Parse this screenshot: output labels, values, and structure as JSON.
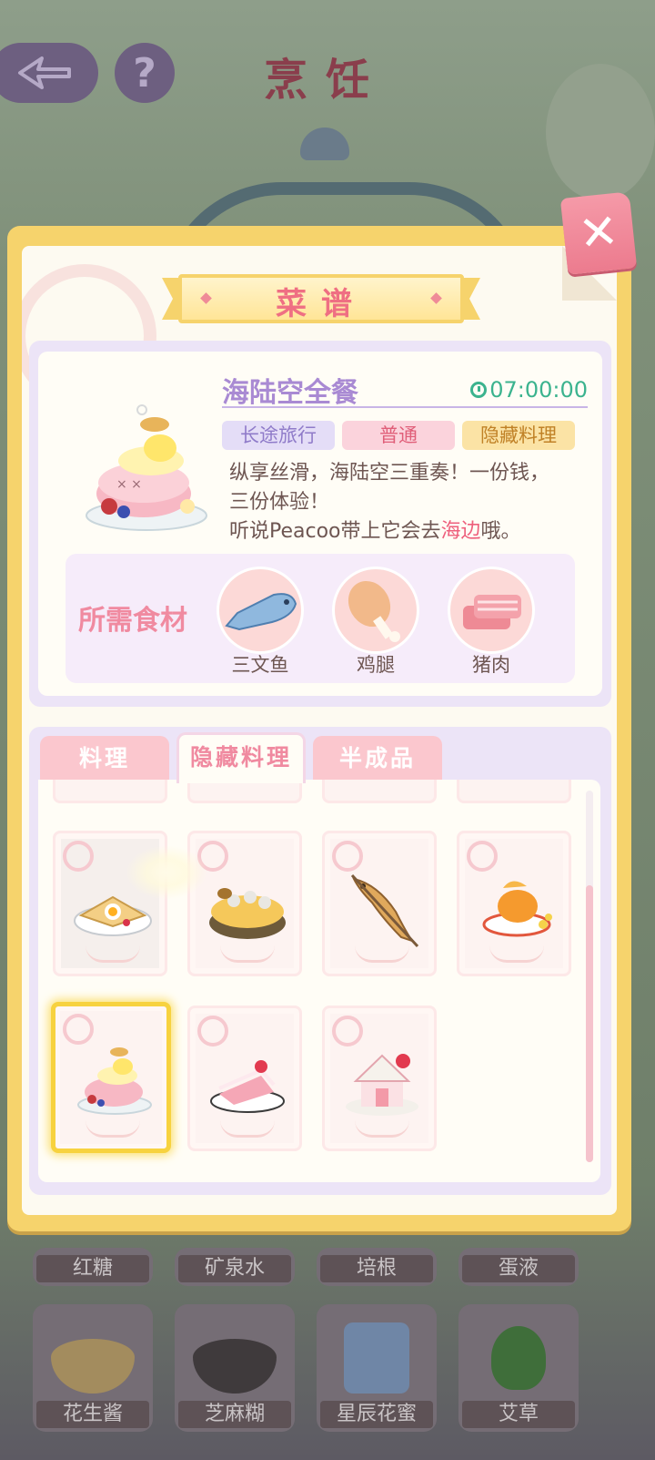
{
  "background": {
    "title": "烹饪",
    "back_icon": "back-arrow-icon",
    "help_label": "?",
    "inventory_row1": [
      "红糖",
      "矿泉水",
      "培根",
      "蛋液"
    ],
    "inventory_row2": [
      "花生酱",
      "芝麻糊",
      "星辰花蜜",
      "艾草"
    ]
  },
  "panel": {
    "title": "菜谱",
    "close_label": "✕"
  },
  "detail": {
    "dish_name": "海陆空全餐",
    "time": "07:00:00",
    "tags": [
      "长途旅行",
      "普通",
      "隐藏料理"
    ],
    "description_line1": "纵享丝滑，海陆空三重奏！一份钱，",
    "description_line2": "三份体验！",
    "description_line3_prefix": "听说Peacoo带上它会去",
    "description_highlight": "海边",
    "description_line3_suffix": "哦。",
    "ingredients_label": "所需食材",
    "ingredients": [
      {
        "name": "三文鱼",
        "icon": "salmon-icon"
      },
      {
        "name": "鸡腿",
        "icon": "drumstick-icon"
      },
      {
        "name": "猪肉",
        "icon": "pork-icon"
      }
    ]
  },
  "tabs": [
    "料理",
    "隐藏料理",
    "半成品"
  ],
  "active_tab": "隐藏料理",
  "recipe_cards": [
    {
      "icon": "egg-crepe-icon"
    },
    {
      "icon": "mushroom-cake-icon"
    },
    {
      "icon": "grilled-fish-icon"
    },
    {
      "icon": "goldfish-dish-icon"
    },
    {
      "icon": "sea-land-sky-meal-icon",
      "selected": true
    },
    {
      "icon": "strawberry-cake-icon"
    },
    {
      "icon": "gingerbread-house-icon"
    }
  ],
  "colors": {
    "accent_pink": "#ef6f83",
    "accent_purple": "#a98ad3",
    "timer_green": "#3bb38e",
    "panel_gold": "#f6d36c"
  }
}
